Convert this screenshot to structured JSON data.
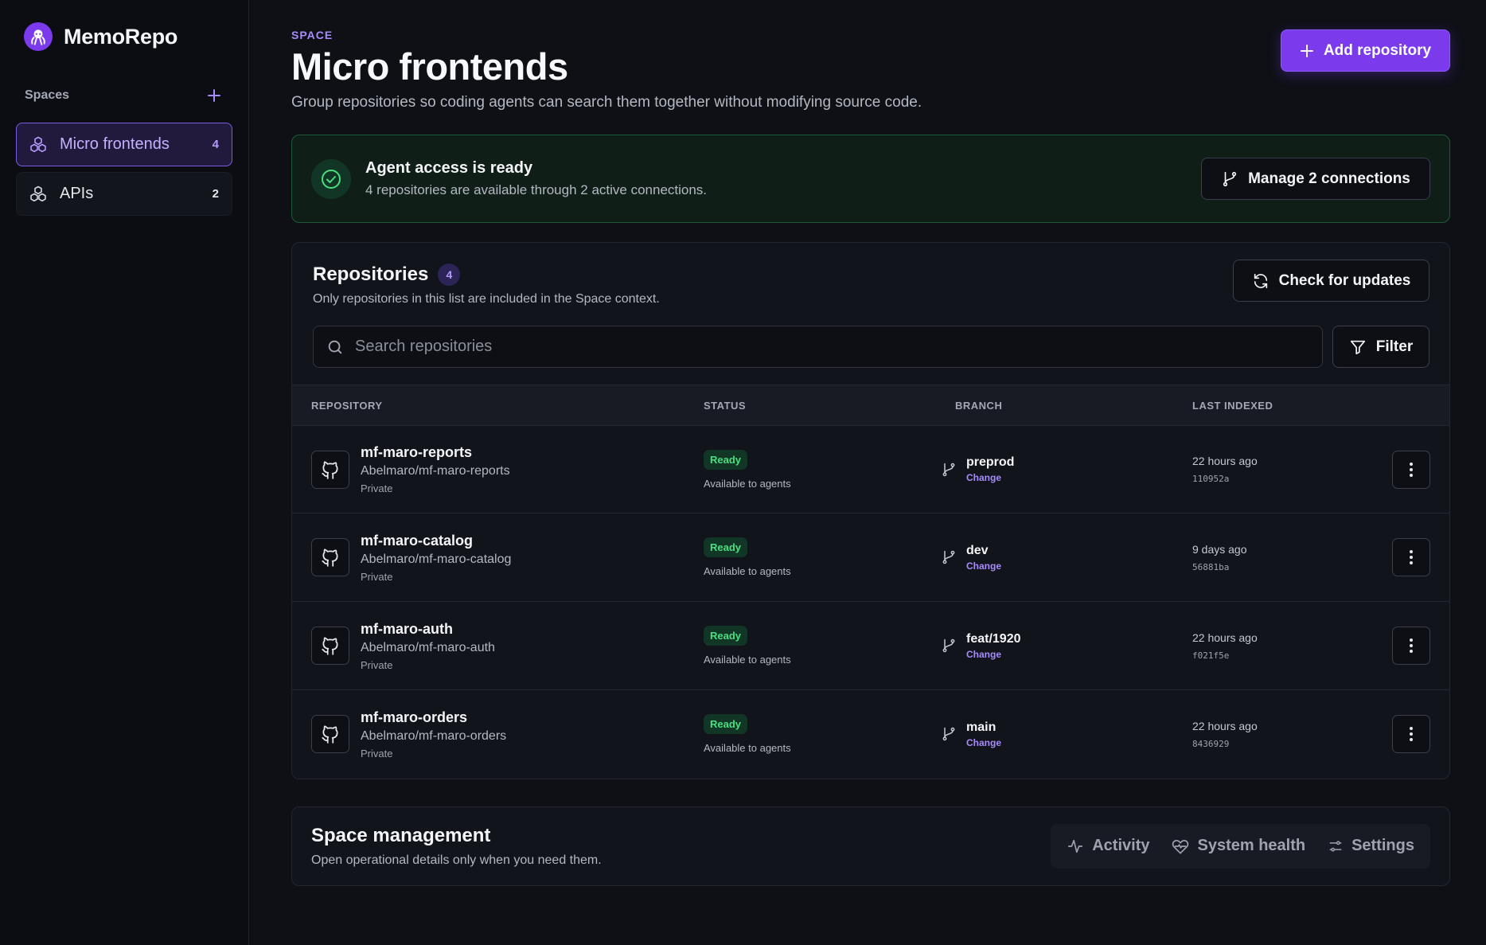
{
  "brand": {
    "name": "MemoRepo",
    "logo_icon": "octopus-icon"
  },
  "sidebar": {
    "section_label": "Spaces",
    "items": [
      {
        "label": "Micro frontends",
        "count": "4",
        "active": true
      },
      {
        "label": "APIs",
        "count": "2",
        "active": false
      }
    ]
  },
  "header": {
    "eyebrow": "SPACE",
    "title": "Micro frontends",
    "subtitle": "Group repositories so coding agents can search them together without modifying source code.",
    "add_button": "Add repository"
  },
  "agent_access": {
    "title": "Agent access is ready",
    "description": "4 repositories are available through 2 active connections.",
    "manage_button": "Manage 2 connections"
  },
  "repositories": {
    "title": "Repositories",
    "count": "4",
    "description": "Only repositories in this list are included in the Space context.",
    "check_button": "Check for updates",
    "search_placeholder": "Search repositories",
    "filter_button": "Filter",
    "columns": [
      "REPOSITORY",
      "STATUS",
      "BRANCH",
      "LAST INDEXED"
    ],
    "rows": [
      {
        "name": "mf-maro-reports",
        "path": "Abelmaro/mf-maro-reports",
        "visibility": "Private",
        "status": "Ready",
        "status_sub": "Available to agents",
        "branch": "preprod",
        "change": "Change",
        "indexed": "22 hours ago",
        "hash": "110952a"
      },
      {
        "name": "mf-maro-catalog",
        "path": "Abelmaro/mf-maro-catalog",
        "visibility": "Private",
        "status": "Ready",
        "status_sub": "Available to agents",
        "branch": "dev",
        "change": "Change",
        "indexed": "9 days ago",
        "hash": "56881ba"
      },
      {
        "name": "mf-maro-auth",
        "path": "Abelmaro/mf-maro-auth",
        "visibility": "Private",
        "status": "Ready",
        "status_sub": "Available to agents",
        "branch": "feat/1920",
        "change": "Change",
        "indexed": "22 hours ago",
        "hash": "f021f5e"
      },
      {
        "name": "mf-maro-orders",
        "path": "Abelmaro/mf-maro-orders",
        "visibility": "Private",
        "status": "Ready",
        "status_sub": "Available to agents",
        "branch": "main",
        "change": "Change",
        "indexed": "22 hours ago",
        "hash": "8436929"
      }
    ]
  },
  "management": {
    "title": "Space management",
    "description": "Open operational details only when you need them.",
    "tabs": [
      "Activity",
      "System health",
      "Settings"
    ]
  },
  "colors": {
    "accent": "#7c3aed",
    "success": "#4ade80",
    "background": "#0e1016"
  }
}
